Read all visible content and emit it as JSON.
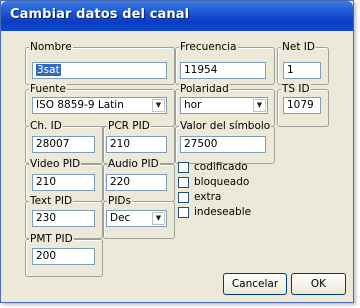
{
  "window": {
    "title": "Cambiar datos del canal"
  },
  "fields": {
    "nombre": {
      "label": "Nombre",
      "value": "3sat"
    },
    "frecuencia": {
      "label": "Frecuencia",
      "value": "11954"
    },
    "net_id": {
      "label": "Net ID",
      "value": "1"
    },
    "fuente": {
      "label": "Fuente",
      "value": "ISO 8859-9 Latin"
    },
    "polaridad": {
      "label": "Polaridad",
      "value": "hor"
    },
    "ts_id": {
      "label": "TS ID",
      "value": "1079"
    },
    "ch_id": {
      "label": "Ch. ID",
      "value": "28007"
    },
    "pcr_pid": {
      "label": "PCR PID",
      "value": "210"
    },
    "valor_simbolo": {
      "label": "Valor del símbolo",
      "value": "27500"
    },
    "video_pid": {
      "label": "Video PID",
      "value": "210"
    },
    "audio_pid": {
      "label": "Audio PID",
      "value": "220"
    },
    "text_pid": {
      "label": "Text PID",
      "value": "230"
    },
    "pids": {
      "label": "PIDs",
      "value": "Dec"
    },
    "pmt_pid": {
      "label": "PMT PID",
      "value": "200"
    }
  },
  "checkboxes": [
    {
      "label": "codificado",
      "checked": false
    },
    {
      "label": "bloqueado",
      "checked": false
    },
    {
      "label": "extra",
      "checked": false
    },
    {
      "label": "indeseable",
      "checked": false
    }
  ],
  "buttons": {
    "cancel": "Cancelar",
    "ok": "OK"
  }
}
